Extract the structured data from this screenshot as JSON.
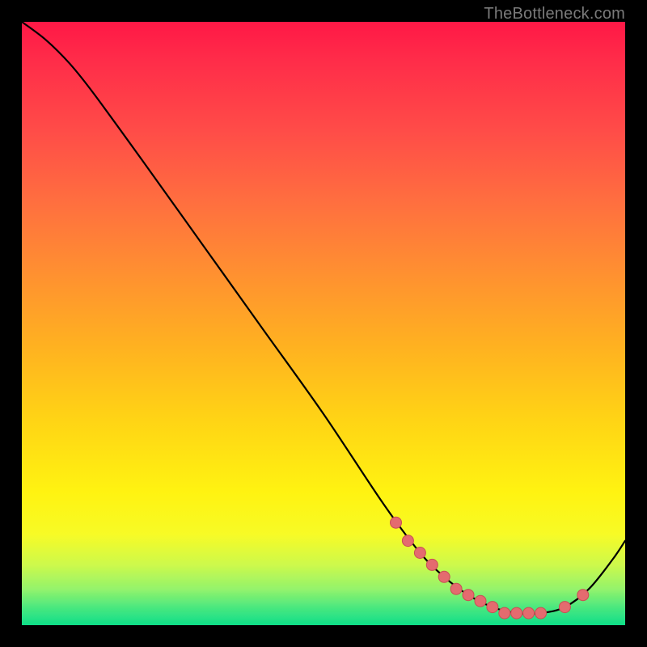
{
  "attribution": "TheBottleneck.com",
  "colors": {
    "curve_stroke": "#000000",
    "marker_fill": "#e46b6f",
    "marker_stroke": "#c94f54",
    "background_black": "#000000"
  },
  "chart_data": {
    "type": "line",
    "title": "",
    "xlabel": "",
    "ylabel": "",
    "xlim": [
      0,
      100
    ],
    "ylim": [
      0,
      100
    ],
    "grid": false,
    "legend": false,
    "series": [
      {
        "name": "bottleneck-curve",
        "x": [
          0,
          4,
          8,
          12,
          20,
          30,
          40,
          50,
          60,
          66,
          70,
          74,
          78,
          82,
          86,
          90,
          94,
          98,
          100
        ],
        "y": [
          100,
          97,
          93,
          88,
          77,
          63,
          49,
          35,
          20,
          12,
          8,
          5,
          3,
          2,
          2,
          3,
          6,
          11,
          14
        ]
      }
    ],
    "markers": {
      "name": "highlighted-points",
      "x": [
        62,
        64,
        66,
        68,
        70,
        72,
        74,
        76,
        78,
        80,
        82,
        84,
        86,
        90,
        93
      ],
      "y": [
        17,
        14,
        12,
        10,
        8,
        6,
        5,
        4,
        3,
        2,
        2,
        2,
        2,
        3,
        5
      ]
    }
  }
}
